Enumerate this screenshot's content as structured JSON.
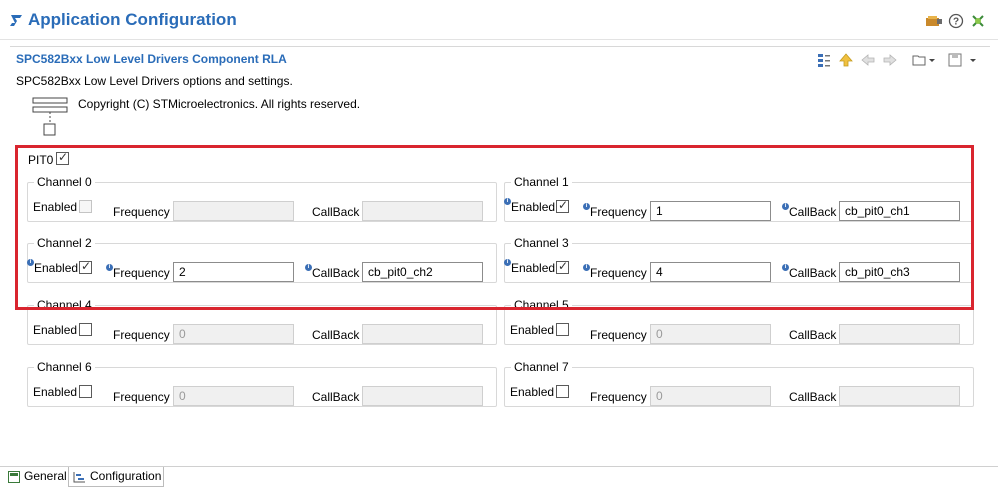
{
  "app": {
    "title": "Application Configuration"
  },
  "section": {
    "title": "SPC582Bxx Low Level Drivers Component RLA",
    "description": "SPC582Bxx Low Level Drivers options and settings.",
    "copyright": "Copyright (C) STMicroelectronics. All rights reserved."
  },
  "pit": {
    "label": "PIT0",
    "checked": true
  },
  "labels": {
    "enabled": "Enabled",
    "frequency": "Frequency",
    "callback": "CallBack"
  },
  "channels": [
    {
      "title": "Channel 0",
      "enabled": false,
      "frequency": "",
      "callback": "",
      "active": false
    },
    {
      "title": "Channel 1",
      "enabled": true,
      "frequency": "1",
      "callback": "cb_pit0_ch1",
      "active": true
    },
    {
      "title": "Channel 2",
      "enabled": true,
      "frequency": "2",
      "callback": "cb_pit0_ch2",
      "active": true
    },
    {
      "title": "Channel 3",
      "enabled": true,
      "frequency": "4",
      "callback": "cb_pit0_ch3",
      "active": true
    },
    {
      "title": "Channel 4",
      "enabled": false,
      "frequency": "0",
      "callback": "",
      "active": false
    },
    {
      "title": "Channel 5",
      "enabled": false,
      "frequency": "0",
      "callback": "",
      "active": false
    },
    {
      "title": "Channel 6",
      "enabled": false,
      "frequency": "0",
      "callback": "",
      "active": false
    },
    {
      "title": "Channel 7",
      "enabled": false,
      "frequency": "0",
      "callback": "",
      "active": false
    }
  ],
  "tabs": [
    {
      "label": "General",
      "icon": "general-tab-icon"
    },
    {
      "label": "Configuration",
      "icon": "configuration-tab-icon"
    }
  ],
  "colors": {
    "accent": "#2a6cb8",
    "highlight": "#d9252f",
    "info": "#3b6fb6"
  }
}
